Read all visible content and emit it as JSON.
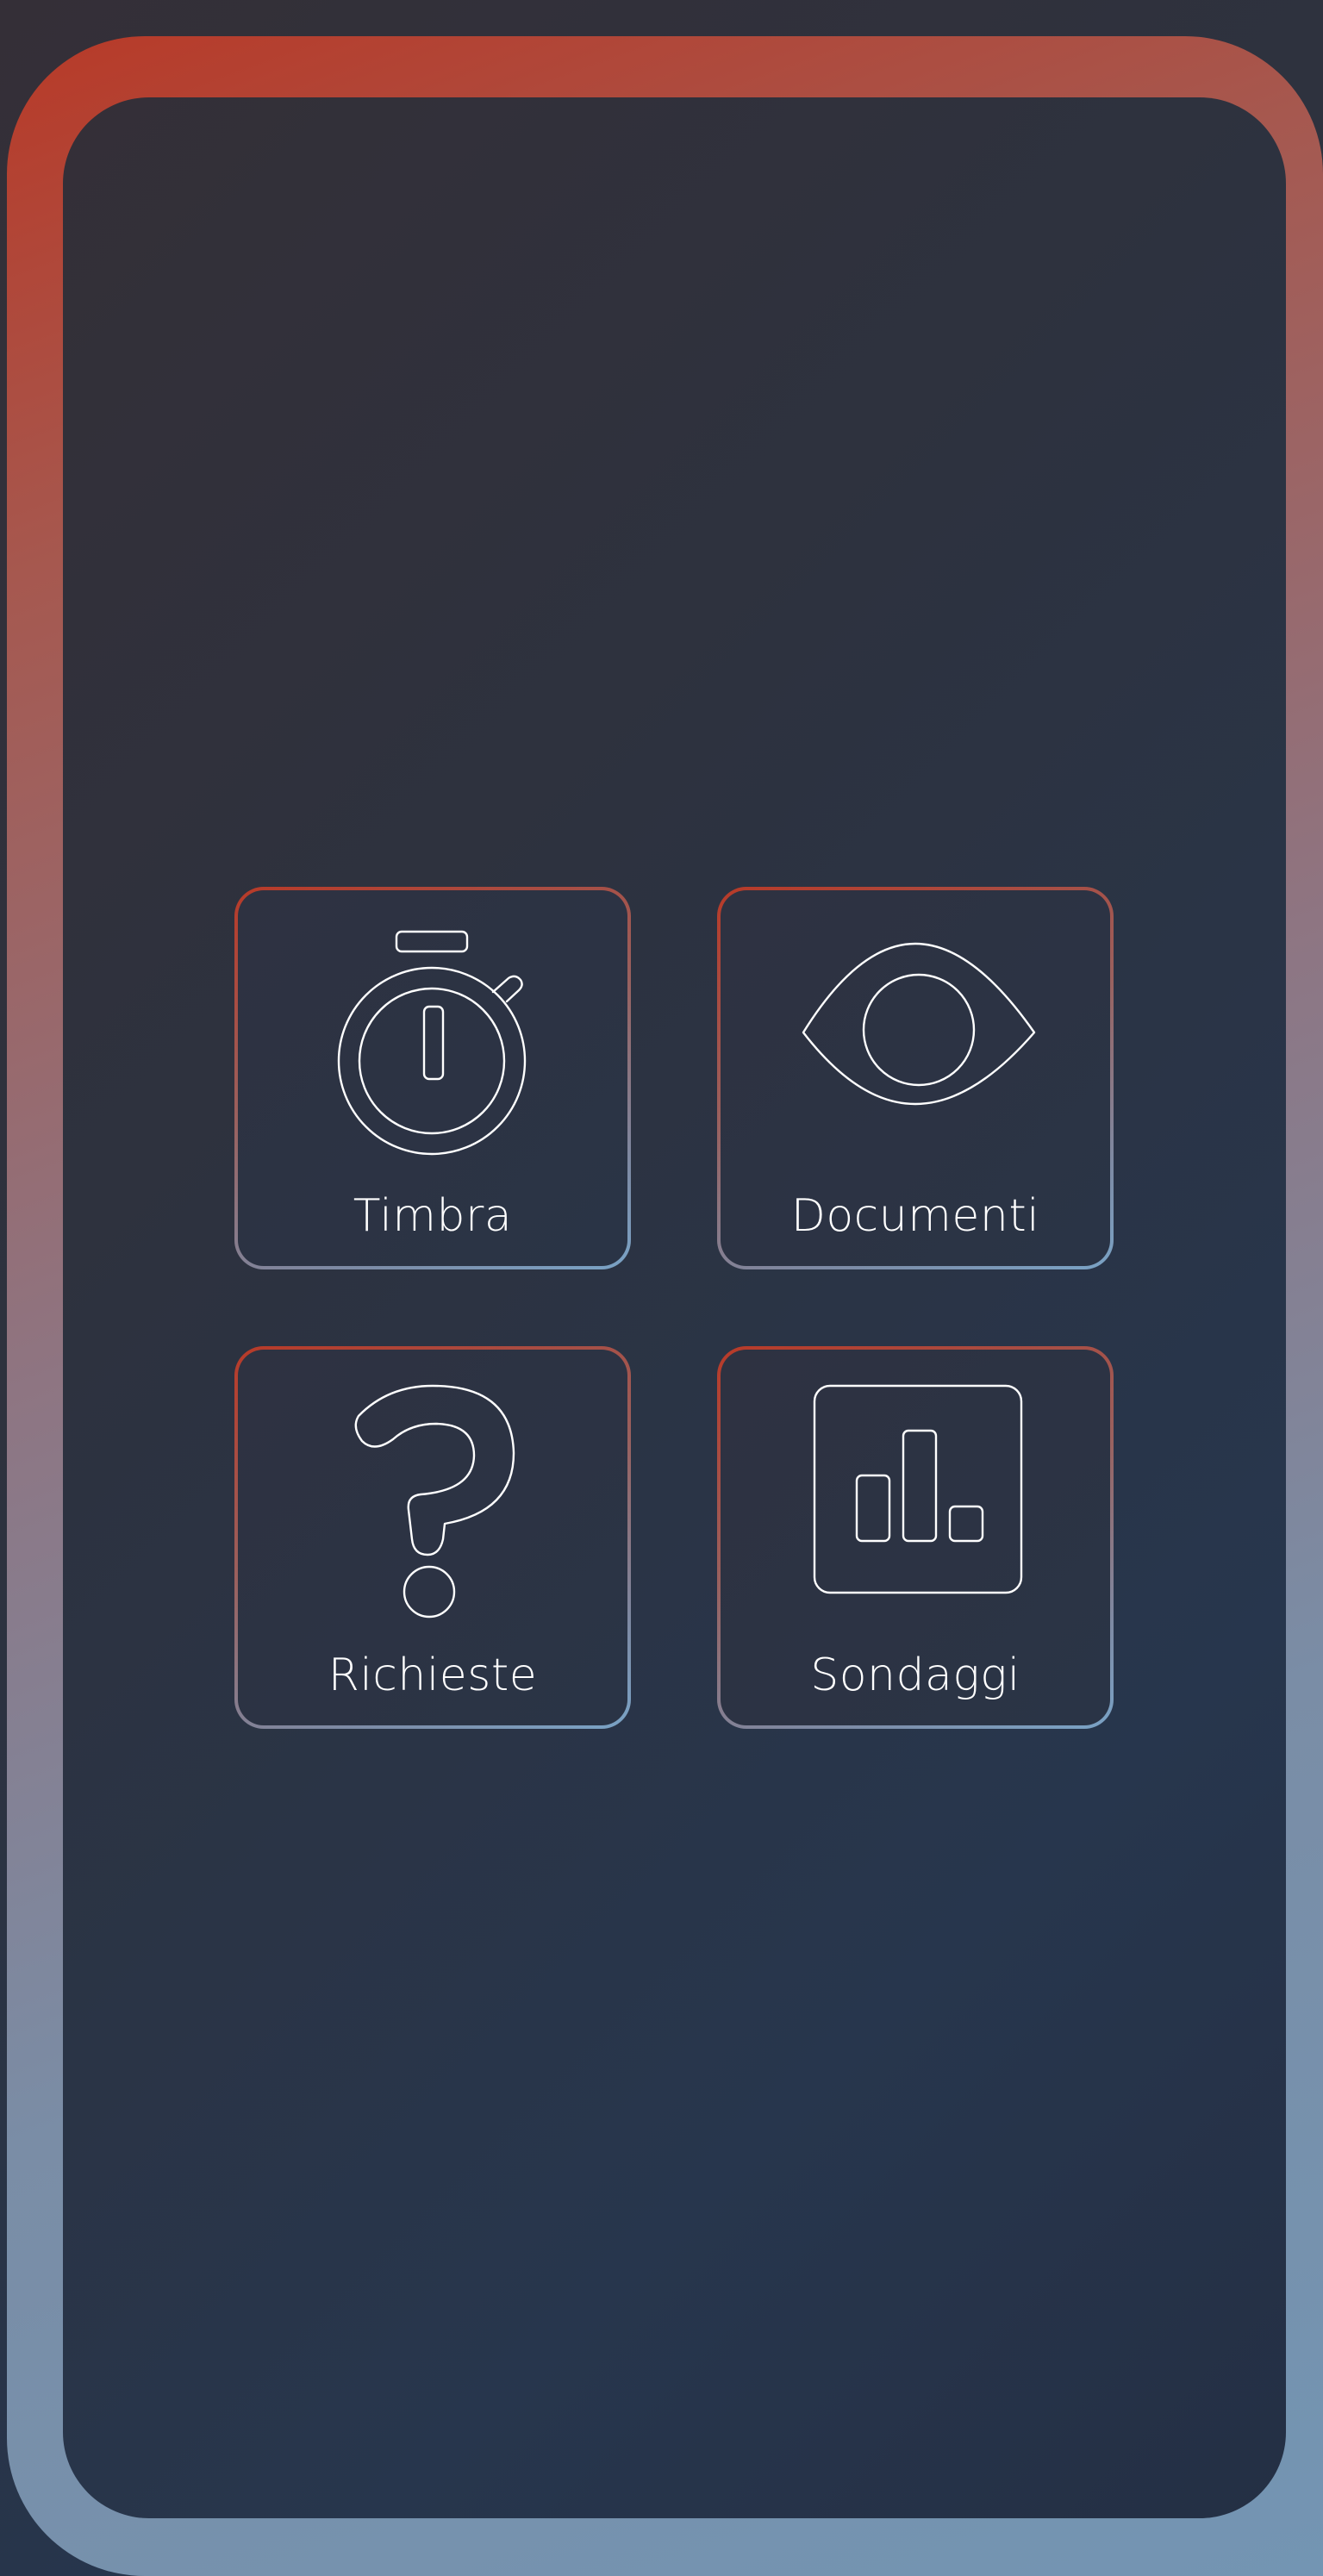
{
  "colors": {
    "accent_warm": "#b83a28",
    "accent_cool": "#7395b3",
    "background": "#2a3446",
    "icon_stroke": "#ffffff"
  },
  "tiles": [
    {
      "label": "Timbra",
      "icon": "stopwatch-icon"
    },
    {
      "label": "Documenti",
      "icon": "eye-icon"
    },
    {
      "label": "Richieste",
      "icon": "question-mark-icon"
    },
    {
      "label": "Sondaggi",
      "icon": "bar-chart-icon"
    }
  ]
}
